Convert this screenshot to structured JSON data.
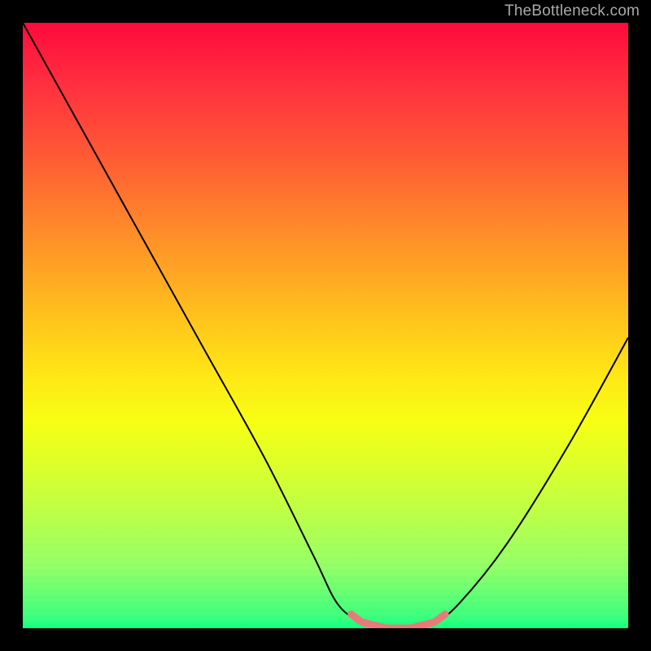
{
  "watermark": "TheBottleneck.com",
  "chart_data": {
    "type": "line",
    "title": "",
    "xlabel": "",
    "ylabel": "",
    "xlim": [
      0,
      100
    ],
    "ylim": [
      0,
      100
    ],
    "grid": false,
    "series": [
      {
        "name": "bottleneck-curve",
        "x": [
          0,
          10,
          20,
          30,
          40,
          48,
          52,
          56,
          60,
          64,
          68,
          72,
          80,
          90,
          100
        ],
        "values": [
          100,
          82,
          64,
          46,
          28,
          12,
          4,
          1,
          0,
          0,
          1,
          4,
          14,
          30,
          48
        ]
      }
    ],
    "annotations": [
      {
        "name": "optimal-zone",
        "x_range": [
          55,
          69
        ],
        "style": "pink-dashes"
      }
    ],
    "colors": {
      "curve": "#000000",
      "optimal_marker": "#e97a7a",
      "gradient_top": "#ff0a3c",
      "gradient_bottom": "#12ff80"
    }
  }
}
